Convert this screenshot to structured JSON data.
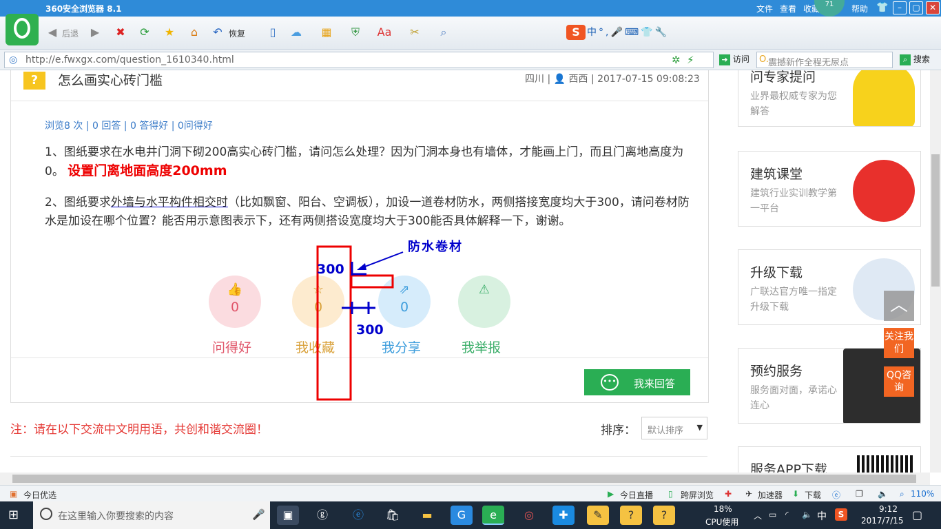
{
  "browser": {
    "title": "360安全浏览器 8.1",
    "menus": [
      "文件",
      "查看",
      "收藏",
      "帮助"
    ],
    "badge": "71",
    "nav": {
      "back": "后退",
      "restore": "恢复"
    },
    "url": "http://e.fwxgx.com/question_1610340.html",
    "go": "访问",
    "search_placeholder": "震撼新作全程无尿点",
    "search_btn": "搜索"
  },
  "question": {
    "icon": "?",
    "title": "怎么画实心砖门槛",
    "meta": "四川 | 👤 西西 | 2017-07-15 09:08:23",
    "stats": "浏览8 次 | 0 回答 | 0 答得好 | 0问得好",
    "p1_a": " 1、图纸要求在水电井门洞下砌200高实心砖门槛，请问怎么处理？因为门洞本身也有墙体，才能画上门，而且门离地高度为0。",
    "p1_ann": "设置门离地面高度200mm",
    "p2_a": "2、图纸要求",
    "p2_ul": "外墙与水平构件相交时",
    "p2_b": "（比如飘窗、阳台、空调板），加设一道卷材防水，两侧搭接宽度均大于300，请问卷材防水是加设在哪个位置？能否用示意图表示下，还有两侧搭设宽度均大于300能否具体解释一下，谢谢。"
  },
  "actions": [
    {
      "icon": "thumb-up-icon",
      "glyph": "👍",
      "count": "0",
      "label": "问得好",
      "color": "#e0566a",
      "bg": "#fbdce0"
    },
    {
      "icon": "star-icon",
      "glyph": "☆",
      "count": "0",
      "label": "我收藏",
      "color": "#d9a13a",
      "bg": "#fdebcf"
    },
    {
      "icon": "share-icon",
      "glyph": "⇗",
      "count": "0",
      "label": "我分享",
      "color": "#3d9ddc",
      "bg": "#d6ecfb"
    },
    {
      "icon": "warning-icon",
      "glyph": "⚠",
      "count": "",
      "label": "我举报",
      "color": "#3cae6a",
      "bg": "#d8f1e0"
    }
  ],
  "answer_btn": "我来回答",
  "notice": "注：请在以下交流中文明用语，共创和谐交流圈！",
  "sort": {
    "label": "排序：",
    "value": "默认排序"
  },
  "annotations": {
    "label_top": "300",
    "label_bottom": "300",
    "label_material": "防水卷材",
    "color_box": "#e00000",
    "color_mark": "#0000cc"
  },
  "sidebar": [
    {
      "title": "问专家提问",
      "desc": "业界最权威专家为您解答"
    },
    {
      "title": "建筑课堂",
      "desc": "建筑行业实训教学第一平台"
    },
    {
      "title": "升级下载",
      "desc": "广联达官方唯一指定升级下载"
    },
    {
      "title": "预约服务",
      "desc": "服务面对面，承诺心连心"
    },
    {
      "title": "服务APP下载",
      "desc": ""
    }
  ],
  "float": {
    "follow": "关注我们",
    "qq": "QQ咨询"
  },
  "statusbar": {
    "left": "今日优选",
    "live": "今日直播",
    "cross": "跨屏浏览",
    "accel": "加速器",
    "download": "下载",
    "zoom": "110%"
  },
  "taskbar": {
    "search": "在这里输入你要搜索的内容",
    "cpu_pct": "18%",
    "cpu_label": "CPU使用",
    "ime": "中",
    "time": "9:12",
    "date": "2017/7/15"
  }
}
